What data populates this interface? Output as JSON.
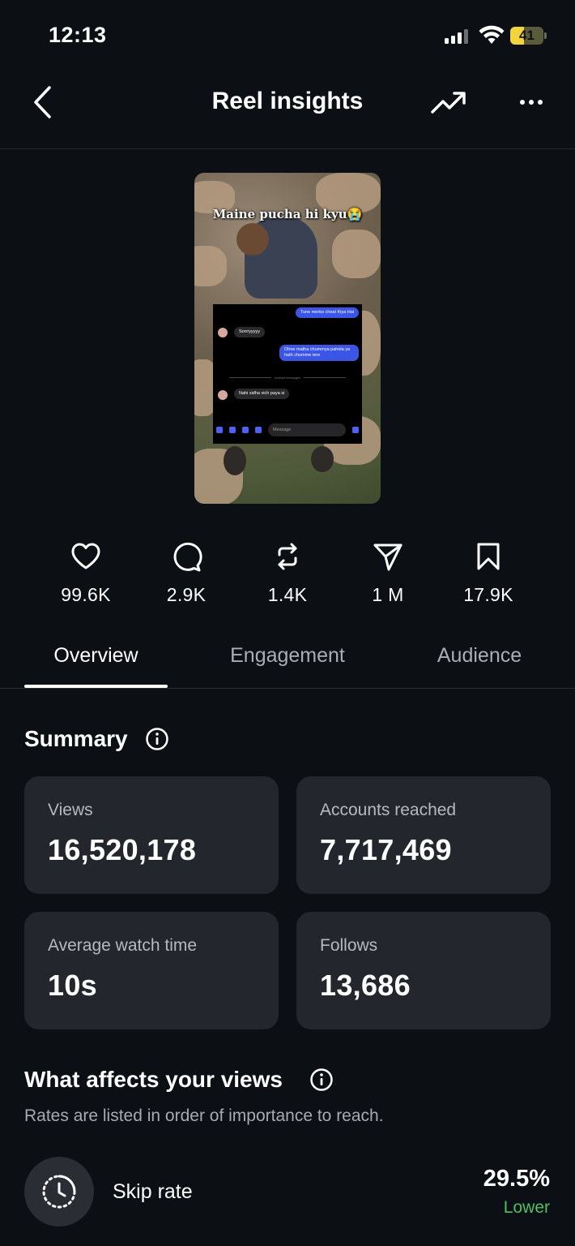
{
  "status_bar": {
    "time": "12:13",
    "battery_level": "41"
  },
  "header": {
    "title": "Reel insights",
    "back_icon": "chevron-left-icon",
    "trend_icon": "trending-up-icon",
    "more_icon": "more-horizontal-icon"
  },
  "reel_preview": {
    "caption": "Maine pucha hi kyu😭",
    "messages": [
      {
        "direction": "out",
        "text": "Tune merko cheat Kiya Hai"
      },
      {
        "direction": "in",
        "text": "Sorrryyyyy"
      },
      {
        "direction": "out",
        "text": "Ohne matha chummya pahela ya hath chumme tere"
      },
      {
        "direction": "in",
        "text": "Nahi sidha vich paya si"
      }
    ],
    "divider_text": "Unread messages",
    "composer_placeholder": "Message"
  },
  "stats": [
    {
      "icon": "heart-icon",
      "value": "99.6K"
    },
    {
      "icon": "comment-icon",
      "value": "2.9K"
    },
    {
      "icon": "repost-icon",
      "value": "1.4K"
    },
    {
      "icon": "share-icon",
      "value": "1 M"
    },
    {
      "icon": "bookmark-icon",
      "value": "17.9K"
    }
  ],
  "tabs": [
    {
      "label": "Overview",
      "active": true
    },
    {
      "label": "Engagement",
      "active": false
    },
    {
      "label": "Audience",
      "active": false
    }
  ],
  "summary": {
    "title": "Summary",
    "cards": [
      {
        "label": "Views",
        "value": "16,520,178"
      },
      {
        "label": "Accounts reached",
        "value": "7,717,469"
      },
      {
        "label": "Average watch time",
        "value": "10s"
      },
      {
        "label": "Follows",
        "value": "13,686"
      }
    ]
  },
  "views_factors": {
    "title": "What affects your views",
    "subtitle": "Rates are listed in order of importance to reach.",
    "items": [
      {
        "label": "Skip rate",
        "value": "29.5%",
        "comparison": "Lower",
        "comparison_color": "#4cc166",
        "icon": "skip-timer-icon"
      }
    ]
  },
  "colors": {
    "background": "#0c0f14",
    "card": "#23262c",
    "positive": "#4cc166",
    "message_out": "#3b55e6"
  }
}
